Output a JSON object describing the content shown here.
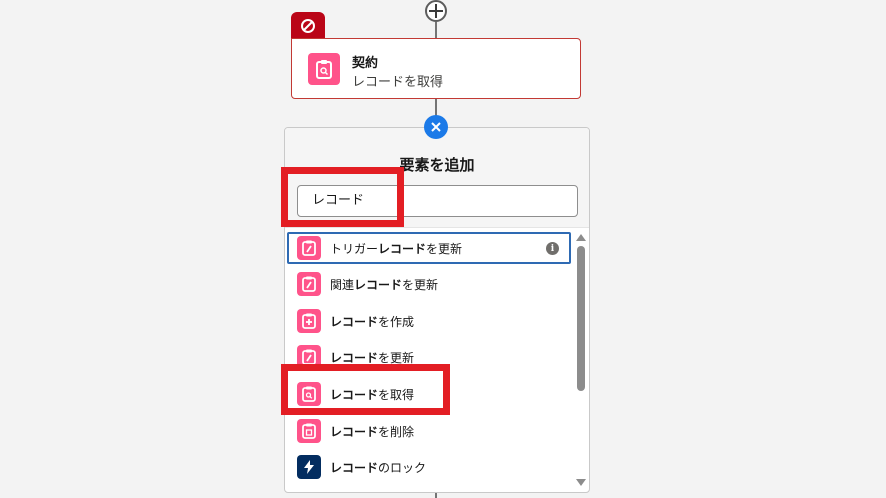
{
  "canvas": {
    "add_icon": "plus-icon",
    "fault_icon": "ban-icon"
  },
  "element": {
    "title": "契約",
    "subtitle": "レコードを取得",
    "icon": "record-lookup-icon",
    "icon_color": "#ff538a",
    "border_color": "#c23934"
  },
  "panel": {
    "title": "要素を追加",
    "search_value": "レコード",
    "close_icon": "close-icon",
    "items": [
      {
        "pre": "トリガー",
        "bold": "レコード",
        "post": "を更新",
        "icon": "record-update-icon",
        "color": "#ff538a"
      },
      {
        "pre": "関連",
        "bold": "レコード",
        "post": "を更新",
        "icon": "record-update-icon",
        "color": "#ff538a"
      },
      {
        "pre": "",
        "bold": "レコード",
        "post": "を作成",
        "icon": "record-create-icon",
        "color": "#ff538a"
      },
      {
        "pre": "",
        "bold": "レコード",
        "post": "を更新",
        "icon": "record-update-icon",
        "color": "#ff538a"
      },
      {
        "pre": "",
        "bold": "レコード",
        "post": "を取得",
        "icon": "record-lookup-icon",
        "color": "#ff538a"
      },
      {
        "pre": "",
        "bold": "レコード",
        "post": "を削除",
        "icon": "record-delete-icon",
        "color": "#ff538a"
      },
      {
        "pre": "",
        "bold": "レコード",
        "post": "のロック",
        "icon": "flash-icon",
        "color": "#032d60"
      }
    ]
  },
  "colors": {
    "highlight": "#e31e24",
    "accent": "#1b7ae8",
    "fault": "#ba0517"
  }
}
